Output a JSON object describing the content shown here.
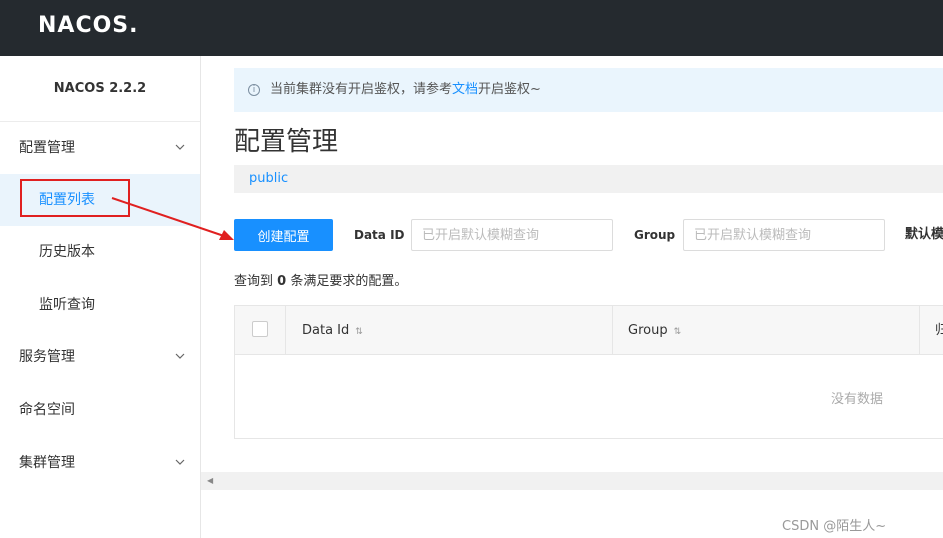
{
  "header": {
    "logo_text": "NACOS.",
    "bg_color": "#252a2f"
  },
  "sidebar": {
    "version": "NACOS 2.2.2",
    "items": [
      {
        "label": "配置管理",
        "expandable": true
      },
      {
        "label": "配置列表",
        "active": true
      },
      {
        "label": "历史版本"
      },
      {
        "label": "监听查询"
      },
      {
        "label": "服务管理",
        "expandable": true
      },
      {
        "label": "命名空间"
      },
      {
        "label": "集群管理",
        "expandable": true
      }
    ]
  },
  "notice": {
    "icon": "info-icon",
    "text_before": "当前集群没有开启鉴权，请参考",
    "link": "文档",
    "text_after": "开启鉴权~"
  },
  "main": {
    "title": "配置管理",
    "namespace": "public",
    "create_button": "创建配置",
    "data_id_label": "Data ID",
    "data_id_placeholder": "已开启默认模糊查询",
    "group_label": "Group",
    "group_placeholder": "已开启默认模糊查询",
    "truncated_label": "默认模",
    "result_prefix": "查询到",
    "result_count": "0",
    "result_suffix": "条满足要求的配置。"
  },
  "table": {
    "columns": [
      "Data Id",
      "Group",
      "归"
    ],
    "empty_text": "没有数据"
  },
  "watermark": "CSDN @陌生人~",
  "colors": {
    "accent": "#1890ff",
    "annotation": "#e02020"
  }
}
